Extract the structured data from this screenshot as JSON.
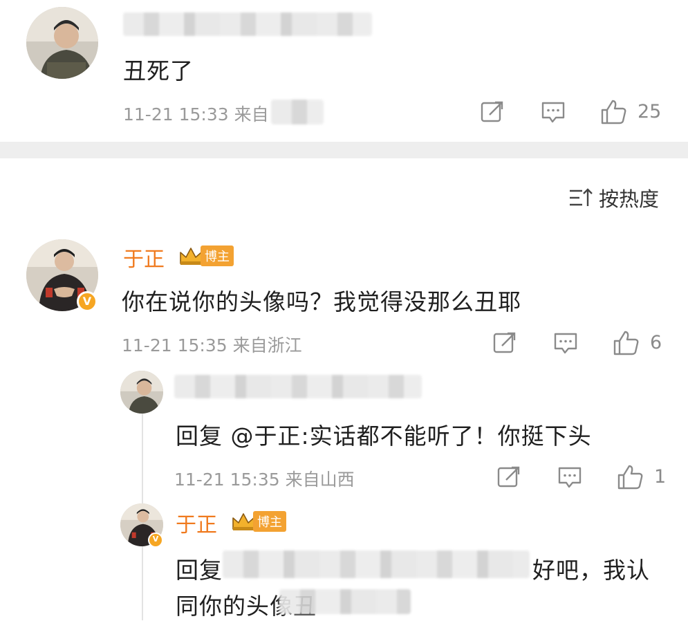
{
  "comment_top": {
    "text": "丑死了",
    "meta": "11-21 15:33  来自",
    "likes": "25"
  },
  "sort": {
    "label": "按热度"
  },
  "comment_main": {
    "author": "于正",
    "badge": "博主",
    "text": "你在说你的头像吗？我觉得没那么丑耶",
    "meta": "11-21 15:35  来自浙江",
    "likes": "6"
  },
  "reply1": {
    "text": "回复 @于正:实话都不能听了！你挺下头",
    "meta": "11-21 15:35  来自山西",
    "likes": "1"
  },
  "reply2": {
    "author": "于正",
    "badge": "博主",
    "text_prefix": "回复",
    "text_suffix": "好吧，我认",
    "text_line2": "同你的头像丑"
  },
  "icons": {
    "share": "share-icon",
    "comment": "comment-icon",
    "like": "thumbs-up-icon",
    "sort": "sort-icon",
    "crown": "crown-icon",
    "verified": "verified-icon"
  },
  "colors": {
    "author": "#f07a1e",
    "badge": "#f3a232",
    "meta": "#9a9a9a",
    "divider": "#eeeeee"
  }
}
